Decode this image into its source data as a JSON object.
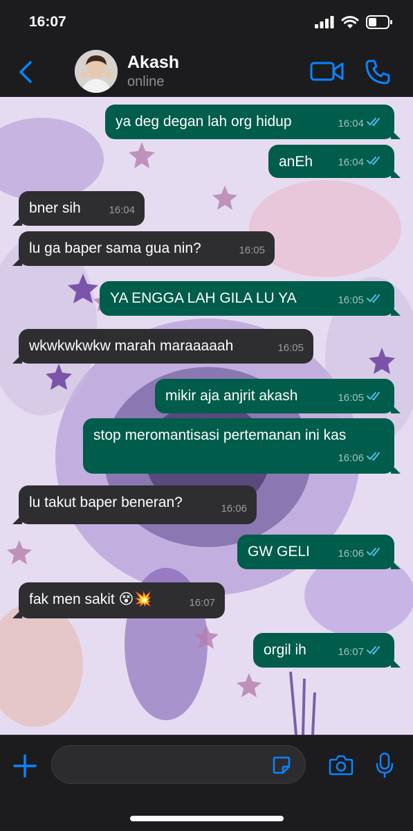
{
  "status_bar": {
    "time": "16:07"
  },
  "header": {
    "name": "Akash",
    "status": "online"
  },
  "messages": [
    {
      "dir": "out",
      "text": "ya deg degan lah org hidup",
      "time": "16:04",
      "read": true
    },
    {
      "dir": "out",
      "text": "anEh",
      "time": "16:04",
      "read": true
    },
    {
      "dir": "in",
      "text": "bner sih",
      "time": "16:04"
    },
    {
      "dir": "in",
      "text": "lu ga baper sama gua nin?",
      "time": "16:05"
    },
    {
      "dir": "out",
      "text": "YA ENGGA LAH GILA LU YA",
      "time": "16:05",
      "read": true
    },
    {
      "dir": "in",
      "text": "wkwkwkwkw marah maraaaaah",
      "time": "16:05"
    },
    {
      "dir": "out",
      "text": "mikir aja anjrit akash",
      "time": "16:05",
      "read": true
    },
    {
      "dir": "out",
      "text": "stop meromantisasi pertemanan ini kas",
      "time": "16:06",
      "read": true
    },
    {
      "dir": "in",
      "text": "lu takut baper beneran?",
      "time": "16:06"
    },
    {
      "dir": "out",
      "text": "GW GELI",
      "time": "16:06",
      "read": true
    },
    {
      "dir": "in",
      "text": "fak men sakit 😵💥",
      "time": "16:07"
    },
    {
      "dir": "out",
      "text": "orgil ih",
      "time": "16:07",
      "read": true
    }
  ],
  "input": {
    "value": "",
    "placeholder": ""
  },
  "colors": {
    "accent": "#0a84ff",
    "outgoing_bubble": "#005c4b",
    "incoming_bubble": "#2e2e30",
    "read_ticks": "#53bdeb"
  },
  "icons": [
    "back-chevron-icon",
    "video-call-icon",
    "phone-icon",
    "plus-icon",
    "sticker-icon",
    "camera-icon",
    "microphone-icon"
  ]
}
